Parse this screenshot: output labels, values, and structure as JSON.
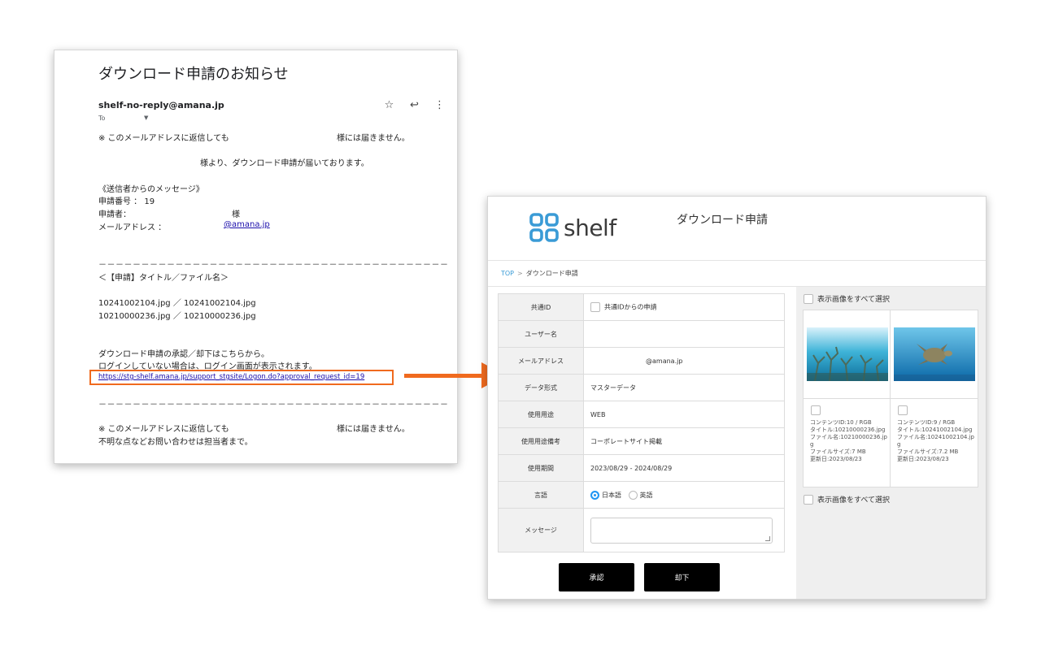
{
  "email": {
    "subject": "ダウンロード申請のお知らせ",
    "sender": "shelf-no-reply@amana.jp",
    "to_label": "To",
    "notice_top_left": "※ このメールアドレスに返信しても",
    "notice_top_right": "様には届きません。",
    "intro": "様より、ダウンロード申請が届いております。",
    "sender_message_header": "《送信者からのメッセージ》",
    "request_number": "申請番号 ： 19",
    "applicant_label": "申請者：",
    "applicant_suffix": "様",
    "email_label": "メールアドレス ：",
    "email_value": "@amana.jp",
    "rule": "－－－－－－－－－－－－－－－－－－－－－－－－－－－－－－－－－－－－－－－－－",
    "files_header": "＜【申請】タイトル／ファイル名＞",
    "files": [
      "10241002104.jpg ／ 10241002104.jpg",
      "10210000236.jpg ／ 10210000236.jpg"
    ],
    "approve_line1": "ダウンロード申請の承認／却下はこちらから。",
    "approve_line2": "ログインしていない場合は、ログイン画面が表示されます。",
    "approve_url": "https://stg-shelf.amana.jp/support_stgsite/Logon.do?approval_request_id=19",
    "notice_bottom_left": "※ このメールアドレスに返信しても",
    "notice_bottom_right": "様には届きません。",
    "footer": "不明な点などお問い合わせは担当者まで。"
  },
  "shelf": {
    "logo_text": "shelf",
    "title": "ダウンロード申請",
    "breadcrumb_top": "TOP",
    "breadcrumb_sep": ">",
    "breadcrumb_current": "ダウンロード申請",
    "form": {
      "common_id_label": "共通ID",
      "common_id_checkbox": "共通IDからの申請",
      "user_label": "ユーザー名",
      "user_value": "",
      "mail_label": "メールアドレス",
      "mail_value": "@amana.jp",
      "format_label": "データ形式",
      "format_value": "マスターデータ",
      "usage_label": "使用用途",
      "usage_value": "WEB",
      "usage_note_label": "使用用途備考",
      "usage_note_value": "コーポレートサイト掲載",
      "period_label": "使用期間",
      "period_value": "2023/08/29 - 2024/08/29",
      "language_label": "言語",
      "language_options": [
        "日本語",
        "英語"
      ],
      "language_selected": "日本語",
      "message_label": "メッセージ",
      "message_value": ""
    },
    "approve_button": "承認",
    "reject_button": "却下",
    "select_all_label": "表示画像をすべて選択",
    "cards": [
      {
        "content": "コンテンツID:10 / RGB",
        "title": "タイトル:10210000236.jpg",
        "filename": "ファイル名:10210000236.jpg",
        "filesize": "ファイルサイズ:7 MB",
        "updated": "更新日:2023/08/23"
      },
      {
        "content": "コンテンツID:9 / RGB",
        "title": "タイトル:10241002104.jpg",
        "filename": "ファイル名:10241002104.jpg",
        "filesize": "ファイルサイズ:7.2 MB",
        "updated": "更新日:2023/08/23"
      }
    ]
  },
  "colors": {
    "highlight_orange": "#f06a1e",
    "logo_blue": "#3a9bd6",
    "button_black": "#000000",
    "radio_blue": "#2196f3"
  }
}
